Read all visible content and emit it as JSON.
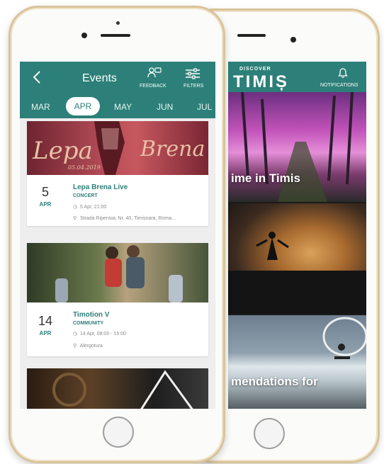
{
  "back_phone": {
    "logo_top": "DISCOVER",
    "logo_main": "TIMIȘ",
    "notifications_label": "NOTIFICATIONS",
    "tiles": [
      {
        "caption": "ime in Timis"
      },
      {
        "caption": ""
      },
      {
        "caption": "mendations for"
      }
    ]
  },
  "front_phone": {
    "header": {
      "title": "Events",
      "feedback_label": "FEEDBACK",
      "filters_label": "FILTERS"
    },
    "months": [
      "MAR",
      "APR",
      "MAY",
      "JUN",
      "JUL"
    ],
    "active_month": "APR",
    "events": [
      {
        "day": "5",
        "month": "APR",
        "title": "Lepa Brena Live",
        "category": "CONCERT",
        "time": "5 Apr, 21:00",
        "location": "Strada Ripensia, Nr. 40, Timișoara, Roma...",
        "image_text_left": "Lepa",
        "image_text_right": "Brena",
        "image_date": "05.04.2019"
      },
      {
        "day": "14",
        "month": "APR",
        "title": "Timotion V",
        "category": "COMMUNITY",
        "time": "14 Apr, 08:00 - 15:00",
        "location": "Alergotura"
      }
    ]
  },
  "colors": {
    "teal": "#2d8079",
    "frame_gold": "#d9c39a"
  }
}
